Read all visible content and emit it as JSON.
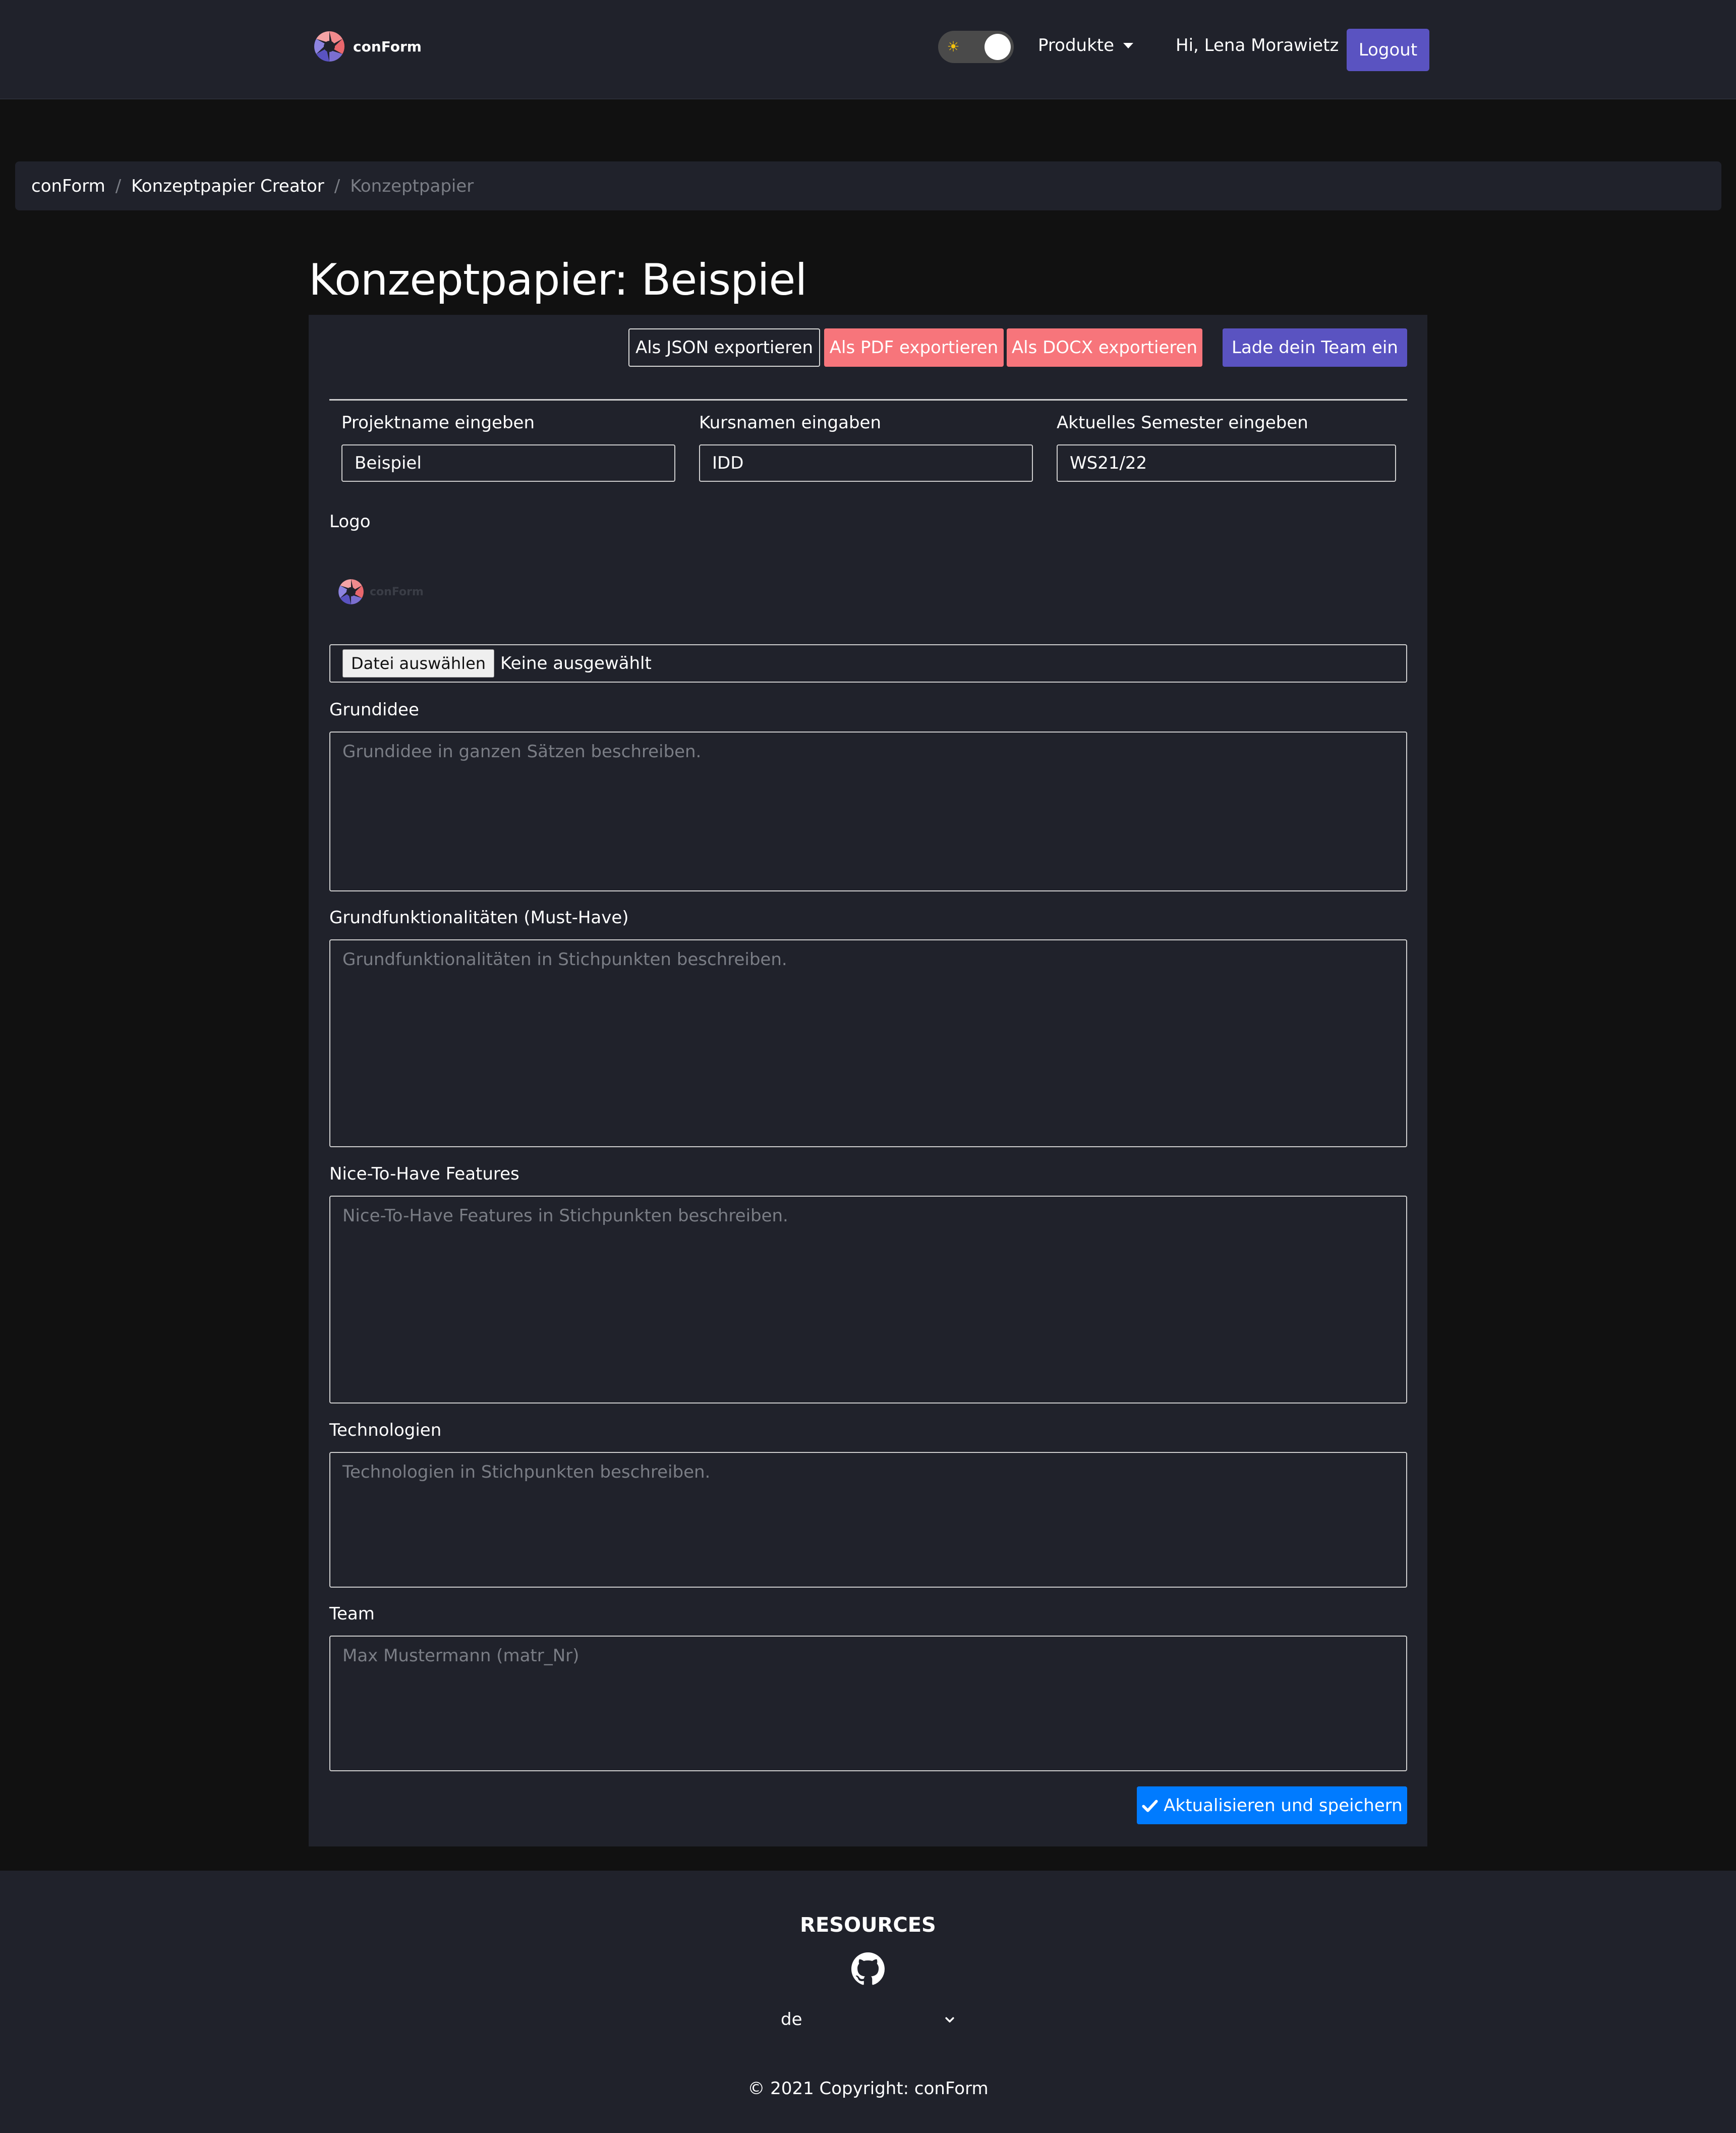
{
  "brand": {
    "name": "conForm"
  },
  "nav": {
    "produkte_label": "Produkte",
    "greeting": "Hi, Lena Morawietz",
    "logout_label": "Logout",
    "theme_icon": "sun-icon"
  },
  "breadcrumb": {
    "items": [
      "conForm",
      "Konzeptpapier Creator"
    ],
    "active": "Konzeptpapier",
    "separator": "/"
  },
  "page": {
    "title": "Konzeptpapier: Beispiel"
  },
  "actions": {
    "json": "Als JSON exportieren",
    "pdf": "Als PDF exportieren",
    "docx": "Als DOCX exportieren",
    "invite": "Lade dein Team ein"
  },
  "form": {
    "project_label": "Projektname eingeben",
    "project_value": "Beispiel",
    "course_label": "Kursnamen eingaben",
    "course_value": "IDD",
    "semester_label": "Aktuelles Semester eingeben",
    "semester_value": "WS21/22",
    "logo_label": "Logo",
    "logo_preview_text": "conForm",
    "file_button": "Datei auswählen",
    "file_status": "Keine ausgewählt",
    "idea_label": "Grundidee",
    "idea_placeholder": "Grundidee in ganzen Sätzen beschreiben.",
    "must_label": "Grundfunktionalitäten (Must-Have)",
    "must_placeholder": "Grundfunktionalitäten in Stichpunkten beschreiben.",
    "nice_label": "Nice-To-Have Features",
    "nice_placeholder": "Nice-To-Have Features in Stichpunkten beschreiben.",
    "tech_label": "Technologien",
    "tech_placeholder": "Technologien in Stichpunkten beschreiben.",
    "team_label": "Team",
    "team_placeholder": "Max Mustermann (matr_Nr)",
    "save_label": "Aktualisieren und speichern"
  },
  "footer": {
    "title": "RESOURCES",
    "language": "de",
    "copyright": "© 2021 Copyright: conForm",
    "icon": "github-icon"
  },
  "colors": {
    "background": "#111111",
    "surface": "#20222b",
    "primary_purple": "#5a53c1",
    "export_red": "#f7757b",
    "save_blue": "#007bff"
  }
}
